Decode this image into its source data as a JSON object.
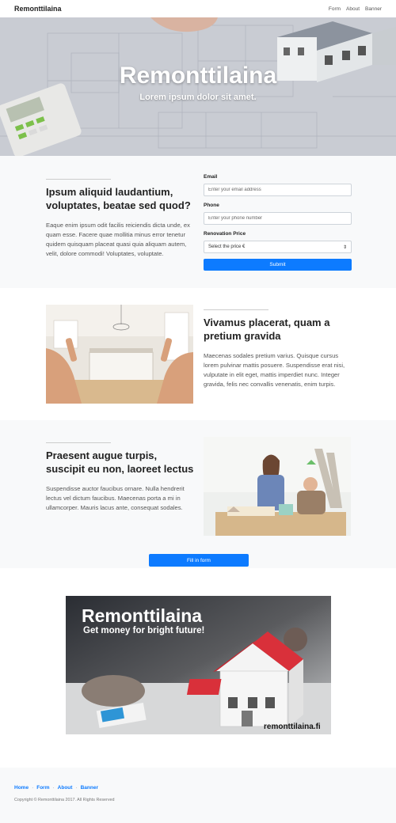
{
  "navbar": {
    "brand": "Remonttilaina",
    "links": [
      "Form",
      "About",
      "Banner"
    ]
  },
  "hero": {
    "title": "Remonttilaina",
    "subtitle": "Lorem ipsum dolor sit amet."
  },
  "form_section": {
    "heading": "Ipsum aliquid laudantium, voluptates, beatae sed quod?",
    "text": "Eaque enim ipsum odit facilis reiciendis dicta unde, ex quam esse. Facere quae mollitia minus error tenetur quidem quisquam placeat quasi quia aliquam autem, velit, dolore commodi! Voluptates, voluptate.",
    "email_label": "Email",
    "email_placeholder": "Enter your email address",
    "phone_label": "Phone",
    "phone_placeholder": "Enter your phone number",
    "price_label": "Renovation Price",
    "price_selected": "Select the price €",
    "submit_label": "Submit"
  },
  "about_1": {
    "heading": "Vivamus placerat, quam a pretium gravida",
    "text": "Maecenas sodales pretium varius. Quisque cursus lorem pulvinar mattis posuere. Suspendisse erat nisi, vulputate in elit eget, mattis imperdiet nunc. Integer gravida, felis nec convallis venenatis, enim turpis."
  },
  "about_2": {
    "heading": "Praesent augue turpis, suscipit eu non, laoreet lectus",
    "text": "Suspendisse auctor faucibus ornare. Nulla hendrerit lectus vel dictum faucibus. Maecenas porta a mi in ullamcorper. Mauris lacus ante, consequat sodales.",
    "cta_label": "Fill in form"
  },
  "banner": {
    "title": "Remonttilaina",
    "subtitle": "Get money for bright future!",
    "site": "remonttilaina.fi"
  },
  "footer": {
    "links": [
      "Home",
      "Form",
      "About",
      "Banner"
    ],
    "copyright": "Copyright © Remonttilaina 2017. All Rights Reserved"
  },
  "colors": {
    "accent": "#0d7bff",
    "section_grey": "#f8f9fa",
    "house_roof": "#d9303a"
  }
}
